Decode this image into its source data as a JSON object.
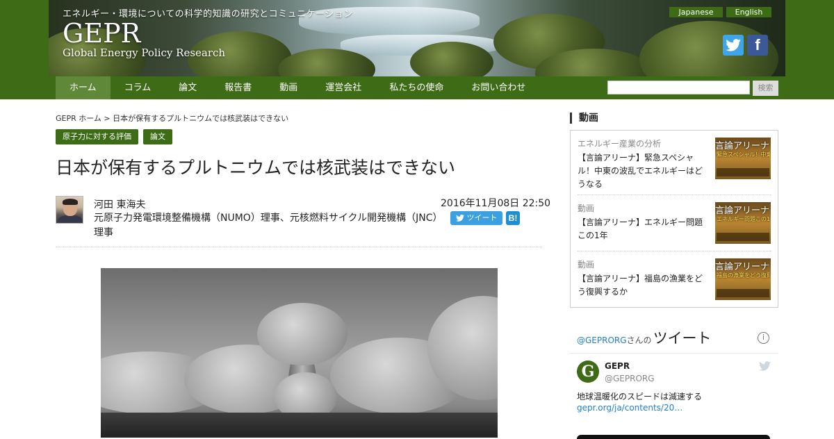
{
  "header": {
    "tagline": "エネルギー・環境についての科学的知識の研究とコミュニケーション",
    "logo": "GEPR",
    "logo_sub": "Global Energy Policy Research",
    "languages": [
      "Japanese",
      "English"
    ],
    "social": [
      "twitter-icon",
      "facebook-icon"
    ],
    "colors": {
      "brand_green": "#3d6b16",
      "nav_active": "#5f8838",
      "twitter": "#3fa5e8",
      "facebook": "#3b5998"
    }
  },
  "nav": {
    "items": [
      "ホーム",
      "コラム",
      "論文",
      "報告書",
      "動画",
      "運営会社",
      "私たちの使命",
      "お問い合わせ"
    ],
    "active": "ホーム",
    "search_placeholder": "",
    "search_button": "検索"
  },
  "article": {
    "breadcrumb": "GEPR ホーム > 日本が保有するプルトニウムでは核武装はできない",
    "categories": [
      "原子力に対する評価",
      "論文"
    ],
    "title": "日本が保有するプルトニウムでは核武装はできない",
    "author_name": "河田 東海夫",
    "author_bio": "元原子力発電環境整備機構（NUMO）理事、元核燃料サイクル開発機構（JNC）理事",
    "date": "2016年11月08日 22:50",
    "tweet_label": "ツイート",
    "hatena_label": "B!"
  },
  "sidebar": {
    "video_heading": "動画",
    "videos": [
      {
        "category": "エネルギー産業の分析",
        "title": "【言論アリーナ】緊急スペシャル！中東の波乱でエネルギーはどうなる",
        "thumb_title": "言論アリーナ",
        "thumb_sub": "緊急スペシャル！中東の波乱でエネルギーはどうなる"
      },
      {
        "category": "動画",
        "title": "【言論アリーナ】エネルギー問題この1年",
        "thumb_title": "言論アリーナ",
        "thumb_sub": "エネルギー問題この1年"
      },
      {
        "category": "動画",
        "title": "【言論アリーナ】福島の漁業をどう復興するか",
        "thumb_title": "言論アリーナ",
        "thumb_sub": "福島の漁業をどう復興するか"
      }
    ],
    "twitter": {
      "handle": "@GEPRORG",
      "san": "さんの",
      "label": "ツイート",
      "tweet_name": "GEPR",
      "tweet_handle": "@GEPRORG",
      "tweet_text": "地球温暖化のスピードは減速する",
      "tweet_link": "gepr.org/ja/contents/20…",
      "avatar_letter": "G"
    }
  }
}
